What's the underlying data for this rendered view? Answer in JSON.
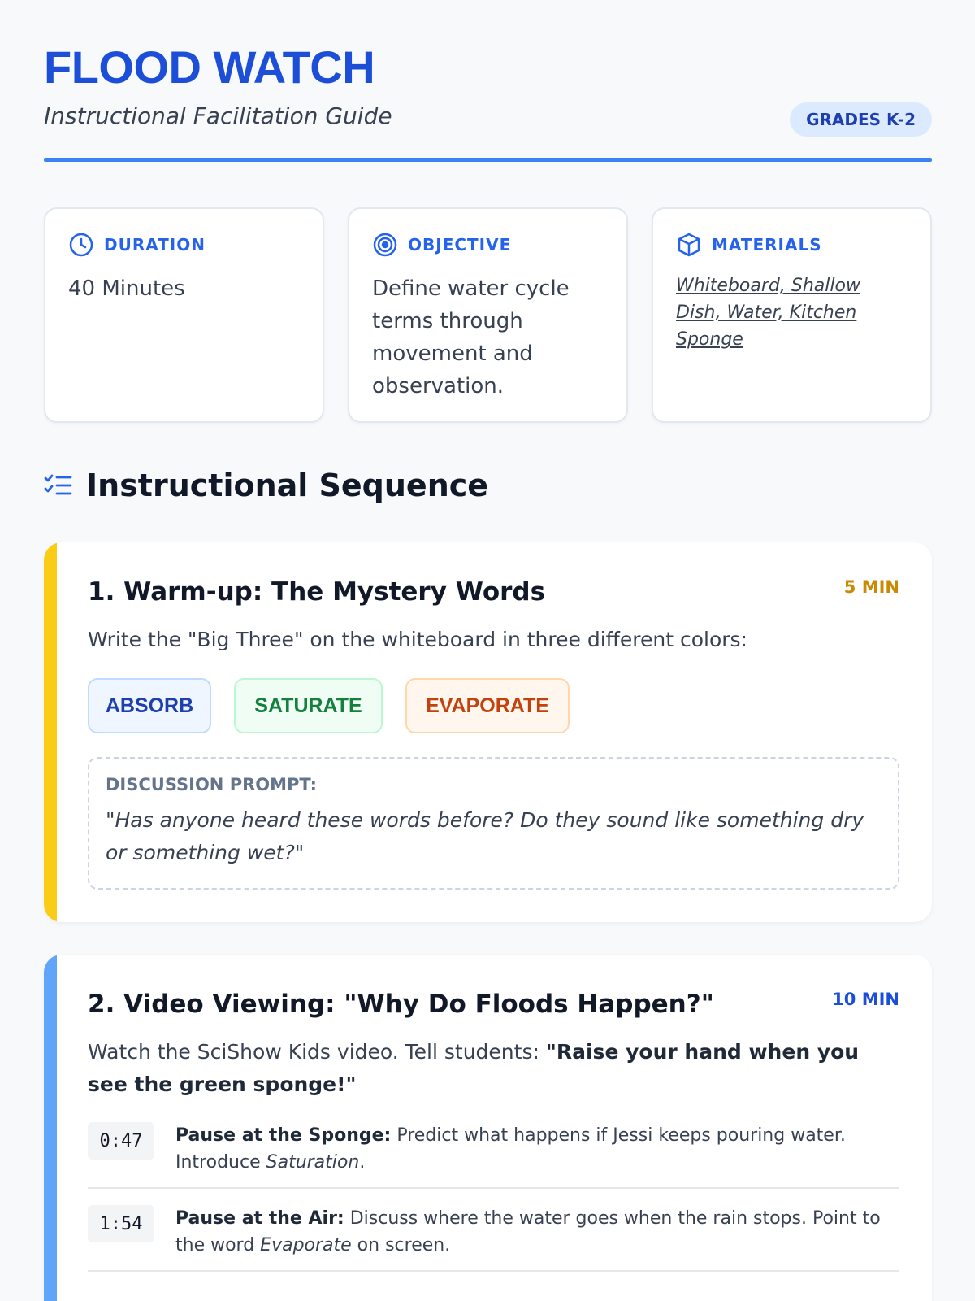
{
  "header": {
    "title": "FLOOD WATCH",
    "subtitle": "Instructional Facilitation Guide",
    "grade": "GRADES K-2"
  },
  "info": {
    "duration": {
      "label": "DURATION",
      "value": "40 Minutes",
      "icon": "clock-icon"
    },
    "objective": {
      "label": "OBJECTIVE",
      "value": "Define water cycle terms through movement and observation.",
      "icon": "target-icon"
    },
    "materials": {
      "label": "MATERIALS",
      "value": "Whiteboard, Shallow Dish, Water, Kitchen Sponge",
      "icon": "cube-icon"
    }
  },
  "sequence": {
    "title": "Instructional Sequence",
    "icon": "checklist-icon",
    "steps": [
      {
        "title": "1. Warm-up: The Mystery Words",
        "time": "5 MIN",
        "description": "Write the \"Big Three\" on the whiteboard in three different colors:",
        "words": [
          "ABSORB",
          "SATURATE",
          "EVAPORATE"
        ],
        "prompt_label": "DISCUSSION PROMPT:",
        "prompt_text": "\"Has anyone heard these words before? Do they sound like something dry or something wet?\"",
        "accent": "#facc15",
        "time_color": "#ca8a04"
      },
      {
        "title": "2. Video Viewing: \"Why Do Floods Happen?\"",
        "time": "10 MIN",
        "description_plain": "Watch the SciShow Kids video. Tell students: ",
        "description_bold": "\"Raise your hand when you see the green sponge!\"",
        "accent": "#60a5fa",
        "time_color": "#1d4ed8",
        "cues": [
          {
            "timestamp": "0:47",
            "lead": "Pause at the Sponge:",
            "text_a": " Predict what happens if Jessi keeps pouring water. Introduce ",
            "term": "Saturation",
            "text_b": "."
          },
          {
            "timestamp": "1:54",
            "lead": "Pause at the Air:",
            "text_a": " Discuss where the water goes when the rain stops. Point to the word ",
            "term": "Evaporate",
            "text_b": " on screen."
          }
        ]
      }
    ]
  },
  "colors": {
    "brand": "#1d4ed8",
    "rule": "#3b82f6",
    "absorb": "#1e40af",
    "saturate": "#15803d",
    "evaporate": "#c2410c"
  }
}
